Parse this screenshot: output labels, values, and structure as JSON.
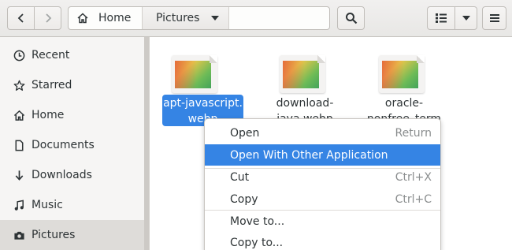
{
  "headerbar": {
    "path": [
      {
        "label": "Home",
        "icon": "home-icon"
      },
      {
        "label": "Pictures",
        "icon": "chevron-down-icon"
      }
    ],
    "buttons": [
      "back-icon",
      "forward-icon",
      "search-icon",
      "list-view-icon",
      "chevron-down-icon",
      "hamburger-menu-icon"
    ]
  },
  "sidebar": {
    "items": [
      {
        "label": "Recent",
        "icon": "clock-icon"
      },
      {
        "label": "Starred",
        "icon": "star-icon"
      },
      {
        "label": "Home",
        "icon": "home-icon"
      },
      {
        "label": "Documents",
        "icon": "document-icon"
      },
      {
        "label": "Downloads",
        "icon": "download-arrow-icon"
      },
      {
        "label": "Music",
        "icon": "music-note-icon"
      },
      {
        "label": "Pictures",
        "icon": "camera-icon",
        "active": true
      }
    ]
  },
  "files": [
    {
      "name_line1": "apt-javascript.",
      "name_line2": "webp",
      "selected": true
    },
    {
      "name_line1": "download-",
      "name_line2": "java.webp",
      "selected": false
    },
    {
      "name_line1": "oracle-",
      "name_line2": "nonfree_term",
      "selected": false
    }
  ],
  "context_menu": {
    "items": [
      {
        "label": "Open",
        "shortcut": "Return"
      },
      {
        "label": "Open With Other Application",
        "shortcut": "",
        "highlighted": true
      },
      {
        "label": "Cut",
        "shortcut": "Ctrl+X"
      },
      {
        "label": "Copy",
        "shortcut": "Ctrl+C"
      },
      {
        "label": "Move to...",
        "shortcut": ""
      },
      {
        "label": "Copy to...",
        "shortcut": ""
      }
    ]
  },
  "colors": {
    "accent": "#3584e4",
    "sidebar_bg": "#f6f5f4",
    "header_bg": "#e8e7e5"
  }
}
